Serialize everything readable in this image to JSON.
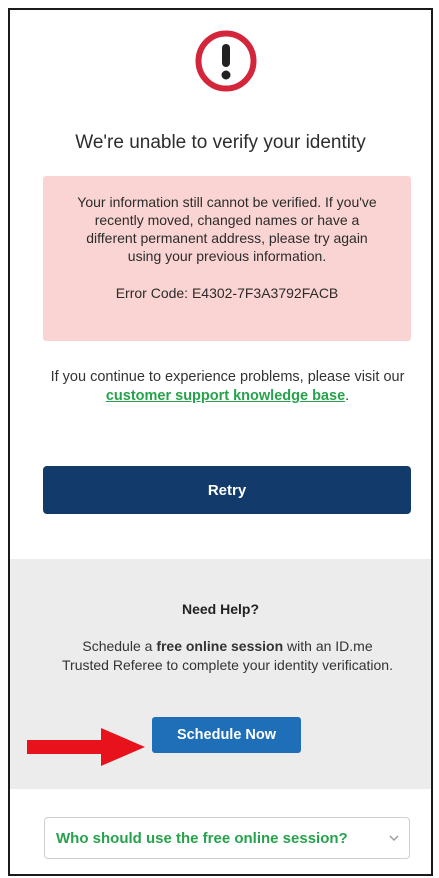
{
  "error": {
    "title": "We're unable to verify your identity",
    "message": "Your information still cannot be verified. If you've recently moved, changed names or have a different permanent address, please try again using your previous information.",
    "code_label": "Error Code: E4302-7F3A3792FACB"
  },
  "support": {
    "prefix": "If you continue to experience problems, please visit our",
    "link_text": "customer support knowledge base",
    "suffix": "."
  },
  "retry_label": "Retry",
  "help": {
    "title": "Need Help?",
    "text_before": "Schedule a",
    "text_bold": "free online session",
    "text_after": "with an ID.me Trusted Referee to complete your identity verification.",
    "schedule_label": "Schedule Now"
  },
  "faq": {
    "question": "Who should use the free online session?"
  },
  "icons": {
    "error": "exclamation-circle-icon",
    "chevron": "chevron-down-icon",
    "annotation": "red-arrow-icon"
  },
  "colors": {
    "alert_background": "#fad4d2",
    "error_red": "#d3263a",
    "link_green": "#27a24c",
    "retry_navy": "#123a6b",
    "schedule_blue": "#1f6fb8",
    "annotation_red": "#e8121d"
  }
}
